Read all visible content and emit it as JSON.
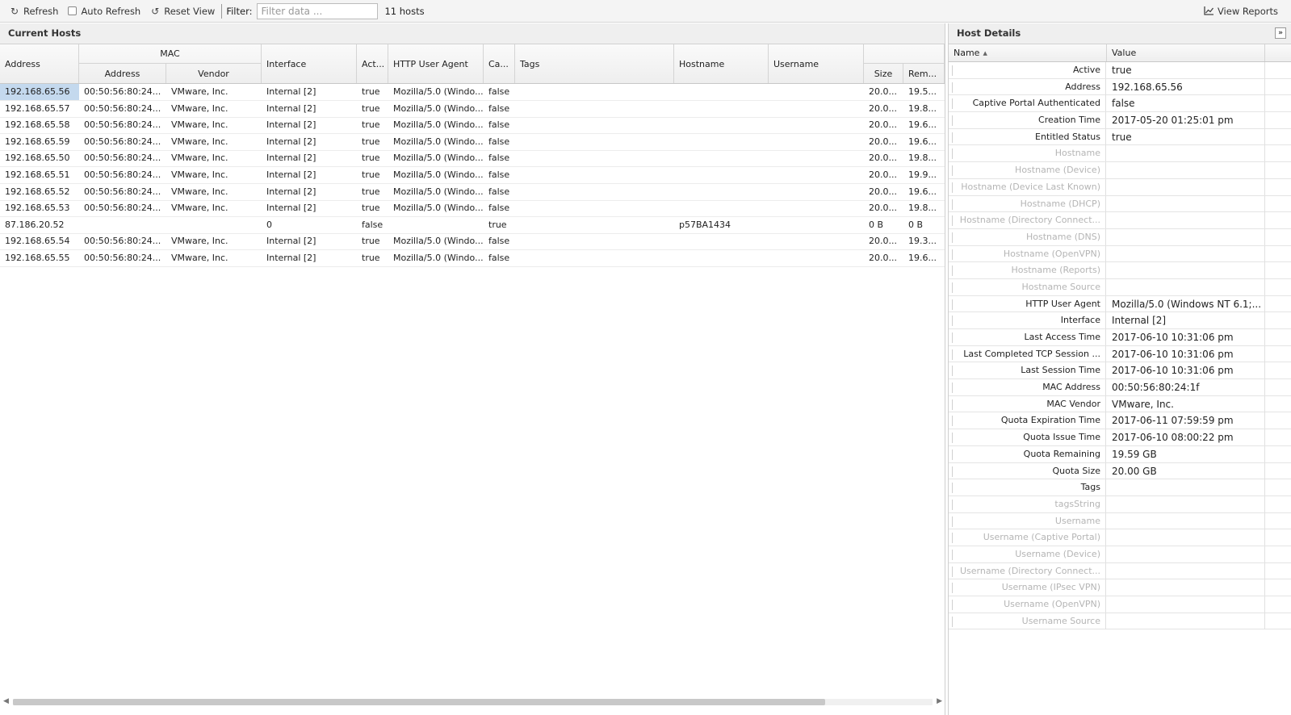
{
  "toolbar": {
    "refresh_label": "Refresh",
    "auto_refresh_label": "Auto Refresh",
    "reset_view_label": "Reset View",
    "filter_label": "Filter:",
    "filter_placeholder": "Filter data ...",
    "host_count": "11 hosts",
    "view_reports_label": "View Reports"
  },
  "hosts_panel": {
    "title": "Current Hosts",
    "headers": {
      "address": "Address",
      "mac_group": "MAC",
      "mac_address": "Address",
      "mac_vendor": "Vendor",
      "interface": "Interface",
      "active": "Act...",
      "user_agent": "HTTP User Agent",
      "captive": "Ca...",
      "tags": "Tags",
      "hostname": "Hostname",
      "username": "Username",
      "size": "Size",
      "remaining": "Rem..."
    },
    "rows": [
      {
        "address": "192.168.65.56",
        "mac": "00:50:56:80:24...",
        "vendor": "VMware, Inc.",
        "interface": "Internal [2]",
        "active": "true",
        "ua": "Mozilla/5.0 (Windo...",
        "captive": "false",
        "tags": "",
        "hostname": "",
        "username": "",
        "size": "20.0...",
        "remaining": "19.5..."
      },
      {
        "address": "192.168.65.57",
        "mac": "00:50:56:80:24...",
        "vendor": "VMware, Inc.",
        "interface": "Internal [2]",
        "active": "true",
        "ua": "Mozilla/5.0 (Windo...",
        "captive": "false",
        "tags": "",
        "hostname": "",
        "username": "",
        "size": "20.0...",
        "remaining": "19.8..."
      },
      {
        "address": "192.168.65.58",
        "mac": "00:50:56:80:24...",
        "vendor": "VMware, Inc.",
        "interface": "Internal [2]",
        "active": "true",
        "ua": "Mozilla/5.0 (Windo...",
        "captive": "false",
        "tags": "",
        "hostname": "",
        "username": "",
        "size": "20.0...",
        "remaining": "19.6..."
      },
      {
        "address": "192.168.65.59",
        "mac": "00:50:56:80:24...",
        "vendor": "VMware, Inc.",
        "interface": "Internal [2]",
        "active": "true",
        "ua": "Mozilla/5.0 (Windo...",
        "captive": "false",
        "tags": "",
        "hostname": "",
        "username": "",
        "size": "20.0...",
        "remaining": "19.6..."
      },
      {
        "address": "192.168.65.50",
        "mac": "00:50:56:80:24...",
        "vendor": "VMware, Inc.",
        "interface": "Internal [2]",
        "active": "true",
        "ua": "Mozilla/5.0 (Windo...",
        "captive": "false",
        "tags": "",
        "hostname": "",
        "username": "",
        "size": "20.0...",
        "remaining": "19.8..."
      },
      {
        "address": "192.168.65.51",
        "mac": "00:50:56:80:24...",
        "vendor": "VMware, Inc.",
        "interface": "Internal [2]",
        "active": "true",
        "ua": "Mozilla/5.0 (Windo...",
        "captive": "false",
        "tags": "",
        "hostname": "",
        "username": "",
        "size": "20.0...",
        "remaining": "19.9..."
      },
      {
        "address": "192.168.65.52",
        "mac": "00:50:56:80:24...",
        "vendor": "VMware, Inc.",
        "interface": "Internal [2]",
        "active": "true",
        "ua": "Mozilla/5.0 (Windo...",
        "captive": "false",
        "tags": "",
        "hostname": "",
        "username": "",
        "size": "20.0...",
        "remaining": "19.6..."
      },
      {
        "address": "192.168.65.53",
        "mac": "00:50:56:80:24...",
        "vendor": "VMware, Inc.",
        "interface": "Internal [2]",
        "active": "true",
        "ua": "Mozilla/5.0 (Windo...",
        "captive": "false",
        "tags": "",
        "hostname": "",
        "username": "",
        "size": "20.0...",
        "remaining": "19.8..."
      },
      {
        "address": "87.186.20.52",
        "mac": "",
        "vendor": "",
        "interface": "0",
        "active": "false",
        "ua": "",
        "captive": "true",
        "tags": "",
        "hostname": "p57BA1434",
        "username": "",
        "size": "0 B",
        "remaining": "0 B"
      },
      {
        "address": "192.168.65.54",
        "mac": "00:50:56:80:24...",
        "vendor": "VMware, Inc.",
        "interface": "Internal [2]",
        "active": "true",
        "ua": "Mozilla/5.0 (Windo...",
        "captive": "false",
        "tags": "",
        "hostname": "",
        "username": "",
        "size": "20.0...",
        "remaining": "19.3..."
      },
      {
        "address": "192.168.65.55",
        "mac": "00:50:56:80:24...",
        "vendor": "VMware, Inc.",
        "interface": "Internal [2]",
        "active": "true",
        "ua": "Mozilla/5.0 (Windo...",
        "captive": "false",
        "tags": "",
        "hostname": "",
        "username": "",
        "size": "20.0...",
        "remaining": "19.6..."
      }
    ]
  },
  "details_panel": {
    "title": "Host Details",
    "name_header": "Name",
    "value_header": "Value",
    "rows": [
      {
        "name": "Active",
        "value": "true",
        "dim": false
      },
      {
        "name": "Address",
        "value": "192.168.65.56",
        "dim": false
      },
      {
        "name": "Captive Portal Authenticated",
        "value": "false",
        "dim": false
      },
      {
        "name": "Creation Time",
        "value": "2017-05-20 01:25:01 pm",
        "dim": false
      },
      {
        "name": "Entitled Status",
        "value": "true",
        "dim": false
      },
      {
        "name": "Hostname",
        "value": "",
        "dim": true
      },
      {
        "name": "Hostname (Device)",
        "value": "",
        "dim": true
      },
      {
        "name": "Hostname (Device Last Known)",
        "value": "",
        "dim": true
      },
      {
        "name": "Hostname (DHCP)",
        "value": "",
        "dim": true
      },
      {
        "name": "Hostname (Directory Connect...",
        "value": "",
        "dim": true
      },
      {
        "name": "Hostname (DNS)",
        "value": "",
        "dim": true
      },
      {
        "name": "Hostname (OpenVPN)",
        "value": "",
        "dim": true
      },
      {
        "name": "Hostname (Reports)",
        "value": "",
        "dim": true
      },
      {
        "name": "Hostname Source",
        "value": "",
        "dim": true
      },
      {
        "name": "HTTP User Agent",
        "value": "Mozilla/5.0 (Windows NT 6.1;...",
        "dim": false
      },
      {
        "name": "Interface",
        "value": "Internal [2]",
        "dim": false
      },
      {
        "name": "Last Access Time",
        "value": "2017-06-10 10:31:06 pm",
        "dim": false
      },
      {
        "name": "Last Completed TCP Session ...",
        "value": "2017-06-10 10:31:06 pm",
        "dim": false
      },
      {
        "name": "Last Session Time",
        "value": "2017-06-10 10:31:06 pm",
        "dim": false
      },
      {
        "name": "MAC Address",
        "value": "00:50:56:80:24:1f",
        "dim": false
      },
      {
        "name": "MAC Vendor",
        "value": "VMware, Inc.",
        "dim": false
      },
      {
        "name": "Quota Expiration Time",
        "value": "2017-06-11 07:59:59 pm",
        "dim": false
      },
      {
        "name": "Quota Issue Time",
        "value": "2017-06-10 08:00:22 pm",
        "dim": false
      },
      {
        "name": "Quota Remaining",
        "value": "19.59 GB",
        "dim": false
      },
      {
        "name": "Quota Size",
        "value": "20.00 GB",
        "dim": false
      },
      {
        "name": "Tags",
        "value": "",
        "dim": false
      },
      {
        "name": "tagsString",
        "value": "",
        "dim": true
      },
      {
        "name": "Username",
        "value": "",
        "dim": true
      },
      {
        "name": "Username (Captive Portal)",
        "value": "",
        "dim": true
      },
      {
        "name": "Username (Device)",
        "value": "",
        "dim": true
      },
      {
        "name": "Username (Directory Connect...",
        "value": "",
        "dim": true
      },
      {
        "name": "Username (IPsec VPN)",
        "value": "",
        "dim": true
      },
      {
        "name": "Username (OpenVPN)",
        "value": "",
        "dim": true
      },
      {
        "name": "Username Source",
        "value": "",
        "dim": true
      }
    ]
  },
  "colors": {
    "selection": "#c4d9ee",
    "dim_text": "#b5b5b5"
  }
}
